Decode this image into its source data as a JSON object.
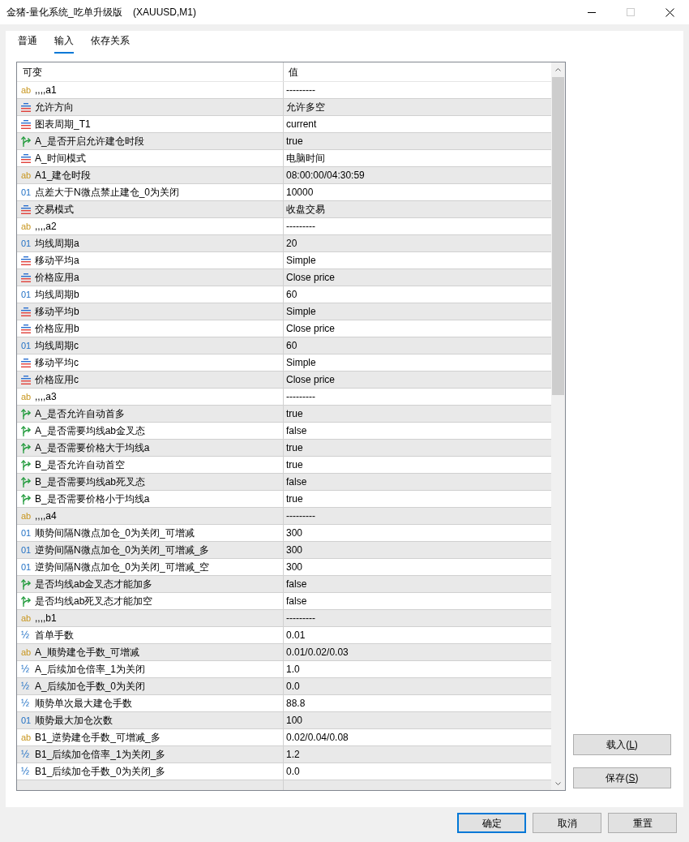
{
  "window": {
    "title": "金猪-量化系统_吃单升级版    (XAUUSD,M1)",
    "maximize_disabled": true
  },
  "tabs": [
    {
      "label": "普通",
      "selected": false
    },
    {
      "label": "输入",
      "selected": true
    },
    {
      "label": "依存关系",
      "selected": false
    }
  ],
  "table": {
    "columns": [
      "可变",
      "值"
    ],
    "rows": [
      {
        "kind": "string",
        "glyph": "ab",
        "name": ",,,,a1",
        "value": "---------"
      },
      {
        "kind": "enum",
        "name": "允许方向",
        "value": "允许多空"
      },
      {
        "kind": "enum",
        "name": "图表周期_T1",
        "value": "current"
      },
      {
        "kind": "bool",
        "name": "A_是否开启允许建仓时段",
        "value": "true"
      },
      {
        "kind": "enum",
        "name": "A_时间模式",
        "value": "电脑时间"
      },
      {
        "kind": "string",
        "glyph": "ab",
        "name": "A1_建仓时段",
        "value": "08:00:00/04:30:59"
      },
      {
        "kind": "int",
        "glyph": "01",
        "name": "点差大于N微点禁止建仓_0为关闭",
        "value": "10000"
      },
      {
        "kind": "enum",
        "name": "交易模式",
        "value": "收盘交易"
      },
      {
        "kind": "string",
        "glyph": "ab",
        "name": ",,,,a2",
        "value": "---------"
      },
      {
        "kind": "int",
        "glyph": "01",
        "name": "均线周期a",
        "value": "20"
      },
      {
        "kind": "enum",
        "name": "移动平均a",
        "value": "Simple"
      },
      {
        "kind": "enum",
        "name": "价格应用a",
        "value": "Close price"
      },
      {
        "kind": "int",
        "glyph": "01",
        "name": "均线周期b",
        "value": "60"
      },
      {
        "kind": "enum",
        "name": "移动平均b",
        "value": "Simple"
      },
      {
        "kind": "enum",
        "name": "价格应用b",
        "value": "Close price"
      },
      {
        "kind": "int",
        "glyph": "01",
        "name": "均线周期c",
        "value": "60"
      },
      {
        "kind": "enum",
        "name": "移动平均c",
        "value": "Simple"
      },
      {
        "kind": "enum",
        "name": "价格应用c",
        "value": "Close price"
      },
      {
        "kind": "string",
        "glyph": "ab",
        "name": ",,,,a3",
        "value": "---------"
      },
      {
        "kind": "bool",
        "name": "A_是否允许自动首多",
        "value": "true"
      },
      {
        "kind": "bool",
        "name": "A_是否需要均线ab金叉态",
        "value": "false"
      },
      {
        "kind": "bool",
        "name": "A_是否需要价格大于均线a",
        "value": "true"
      },
      {
        "kind": "bool",
        "name": "B_是否允许自动首空",
        "value": "true"
      },
      {
        "kind": "bool",
        "name": "B_是否需要均线ab死叉态",
        "value": "false"
      },
      {
        "kind": "bool",
        "name": "B_是否需要价格小于均线a",
        "value": "true"
      },
      {
        "kind": "string",
        "glyph": "ab",
        "name": ",,,,a4",
        "value": "---------"
      },
      {
        "kind": "int",
        "glyph": "01",
        "name": "顺势间隔N微点加仓_0为关闭_可增减",
        "value": "300"
      },
      {
        "kind": "int",
        "glyph": "01",
        "name": "逆势间隔N微点加仓_0为关闭_可增减_多",
        "value": "300"
      },
      {
        "kind": "int",
        "glyph": "01",
        "name": "逆势间隔N微点加仓_0为关闭_可增减_空",
        "value": "300"
      },
      {
        "kind": "bool",
        "name": "是否均线ab金叉态才能加多",
        "value": "false"
      },
      {
        "kind": "bool",
        "name": "是否均线ab死叉态才能加空",
        "value": "false"
      },
      {
        "kind": "string",
        "glyph": "ab",
        "name": ",,,,b1",
        "value": "---------"
      },
      {
        "kind": "double",
        "glyph": "½",
        "name": "首单手数",
        "value": "0.01"
      },
      {
        "kind": "string",
        "glyph": "ab",
        "name": "A_顺势建仓手数_可增减",
        "value": "0.01/0.02/0.03"
      },
      {
        "kind": "double",
        "glyph": "½",
        "name": "A_后续加仓倍率_1为关闭",
        "value": "1.0"
      },
      {
        "kind": "double",
        "glyph": "½",
        "name": "A_后续加仓手数_0为关闭",
        "value": "0.0"
      },
      {
        "kind": "double",
        "glyph": "½",
        "name": "顺势单次最大建仓手数",
        "value": "88.8"
      },
      {
        "kind": "int",
        "glyph": "01",
        "name": "顺势最大加仓次数",
        "value": "100"
      },
      {
        "kind": "string",
        "glyph": "ab",
        "name": "B1_逆势建仓手数_可增减_多",
        "value": "0.02/0.04/0.08"
      },
      {
        "kind": "double",
        "glyph": "½",
        "name": "B1_后续加仓倍率_1为关闭_多",
        "value": "1.2"
      },
      {
        "kind": "double",
        "glyph": "½",
        "name": "B1_后续加仓手数_0为关闭_多",
        "value": "0.0"
      }
    ]
  },
  "side_buttons": [
    {
      "before": "载入(",
      "mnemonic": "L",
      "after": ")"
    },
    {
      "before": "保存(",
      "mnemonic": "S",
      "after": ")"
    }
  ],
  "footer_buttons": [
    {
      "label": "确定",
      "default": true
    },
    {
      "label": "取消",
      "default": false
    },
    {
      "label": "重置",
      "default": false
    }
  ]
}
